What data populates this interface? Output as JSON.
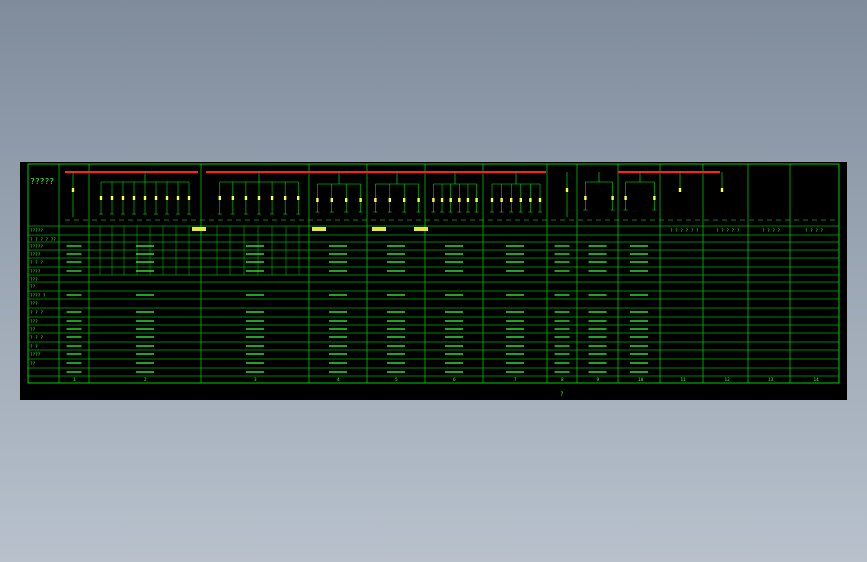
{
  "drawing": {
    "caption": "?",
    "title_block_label": "?????",
    "header_labels": [
      "?????",
      "? ? ? ? ? ?",
      "? ? ? ? ?",
      "? ? ? ?",
      "? ? ? ?"
    ],
    "row_labels": [
      "?????",
      "? ? ? ? ??",
      "?????",
      "????",
      "? ? ?",
      "????",
      "???",
      "??",
      "???? ?",
      "???",
      "? ? ?",
      "???",
      "??",
      "? ? ?",
      "? ?",
      "????",
      "??"
    ],
    "panel_numbers": [
      "1",
      "2",
      "3",
      "4",
      "5",
      "6",
      "7",
      "8",
      "9",
      "10",
      "11",
      "12",
      "13",
      "14"
    ]
  },
  "colors": {
    "background": "#000000",
    "grid": "#00ff00",
    "text": "#3cff3c",
    "busbar": "#ff2020",
    "device": "#ffff44"
  }
}
